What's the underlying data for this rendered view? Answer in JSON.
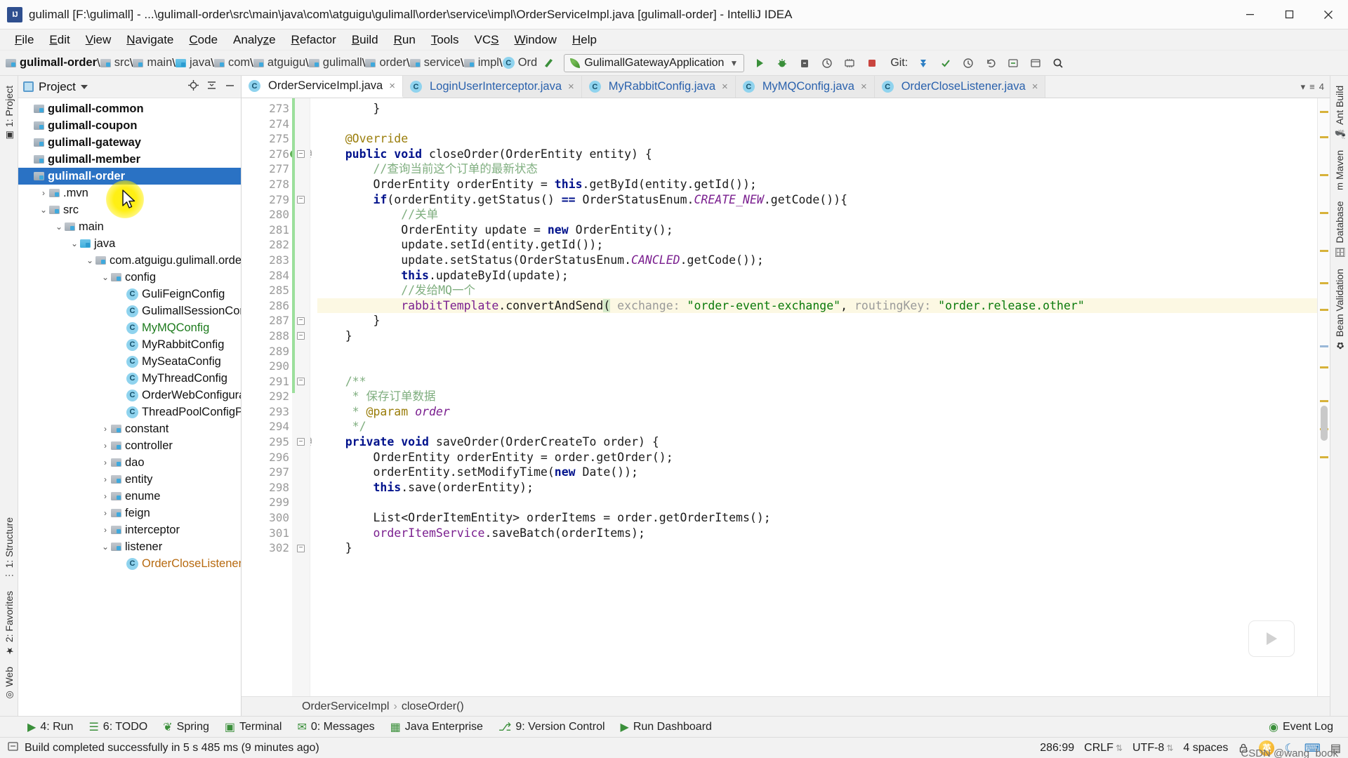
{
  "window": {
    "title": "gulimall [F:\\gulimall] - ...\\gulimall-order\\src\\main\\java\\com\\atguigu\\gulimall\\order\\service\\impl\\OrderServiceImpl.java [gulimall-order] - IntelliJ IDEA",
    "app_icon": "intellij-idea-icon",
    "minimize": "minimize-icon",
    "maximize": "maximize-icon",
    "close": "close-icon"
  },
  "menu": [
    {
      "label": "File",
      "mnemonic": "F"
    },
    {
      "label": "Edit",
      "mnemonic": "E"
    },
    {
      "label": "View",
      "mnemonic": "V"
    },
    {
      "label": "Navigate",
      "mnemonic": "N"
    },
    {
      "label": "Code",
      "mnemonic": "C"
    },
    {
      "label": "Analyze",
      "mnemonic": "z"
    },
    {
      "label": "Refactor",
      "mnemonic": "R"
    },
    {
      "label": "Build",
      "mnemonic": "B"
    },
    {
      "label": "Run",
      "mnemonic": "R"
    },
    {
      "label": "Tools",
      "mnemonic": "T"
    },
    {
      "label": "VCS",
      "mnemonic": "S"
    },
    {
      "label": "Window",
      "mnemonic": "W"
    },
    {
      "label": "Help",
      "mnemonic": "H"
    }
  ],
  "navbar": {
    "crumbs": [
      {
        "label": "gulimall-order",
        "icon": "module-folder-icon",
        "bold": true
      },
      {
        "label": "src",
        "icon": "folder-icon"
      },
      {
        "label": "main",
        "icon": "folder-icon"
      },
      {
        "label": "java",
        "icon": "source-folder-icon"
      },
      {
        "label": "com",
        "icon": "package-icon"
      },
      {
        "label": "atguigu",
        "icon": "package-icon"
      },
      {
        "label": "gulimall",
        "icon": "package-icon"
      },
      {
        "label": "order",
        "icon": "package-icon"
      },
      {
        "label": "service",
        "icon": "package-icon"
      },
      {
        "label": "impl",
        "icon": "package-icon"
      },
      {
        "label": "Ord",
        "icon": "class-icon"
      }
    ],
    "run_config": "GulimallGatewayApplication",
    "git_label": "Git:",
    "buttons": [
      "build-icon",
      "run-icon",
      "debug-icon",
      "run-with-coverage-icon",
      "profile-icon",
      "stop-icon",
      "git-update-icon",
      "git-commit-icon",
      "history-icon",
      "undo-icon",
      "select-in-icon",
      "settings-icon",
      "search-icon"
    ]
  },
  "left_rail": [
    {
      "label": "1: Project",
      "icon": "project-icon"
    },
    {
      "label": "1: Structure",
      "icon": "structure-icon"
    },
    {
      "label": "2: Favorites",
      "icon": "favorites-icon"
    },
    {
      "label": "Web",
      "icon": "web-icon"
    }
  ],
  "right_rail": [
    {
      "label": "Ant Build",
      "icon": "ant-icon"
    },
    {
      "label": "Maven",
      "icon": "maven-icon"
    },
    {
      "label": "Database",
      "icon": "database-icon"
    },
    {
      "label": "Bean Validation",
      "icon": "bean-validation-icon"
    }
  ],
  "project_panel": {
    "title": "Project",
    "actions": [
      "locate-icon",
      "collapse-all-icon",
      "minimize-icon"
    ],
    "tree": [
      {
        "indent": 0,
        "arrow": "",
        "icon": "module-icon",
        "label": "gulimall-common",
        "bold": true
      },
      {
        "indent": 0,
        "arrow": "",
        "icon": "module-icon",
        "label": "gulimall-coupon",
        "bold": true
      },
      {
        "indent": 0,
        "arrow": "",
        "icon": "module-icon",
        "label": "gulimall-gateway",
        "bold": true
      },
      {
        "indent": 0,
        "arrow": "",
        "icon": "module-icon",
        "label": "gulimall-member",
        "bold": true
      },
      {
        "indent": 0,
        "arrow": "",
        "icon": "module-icon",
        "label": "gulimall-order",
        "bold": true,
        "selected": true
      },
      {
        "indent": 1,
        "arrow": "›",
        "icon": "folder-icon",
        "label": ".mvn"
      },
      {
        "indent": 1,
        "arrow": "⌄",
        "icon": "folder-icon",
        "label": "src"
      },
      {
        "indent": 2,
        "arrow": "⌄",
        "icon": "folder-icon",
        "label": "main"
      },
      {
        "indent": 3,
        "arrow": "⌄",
        "icon": "source-folder-icon",
        "label": "java"
      },
      {
        "indent": 4,
        "arrow": "⌄",
        "icon": "package-icon",
        "label": "com.atguigu.gulimall.order"
      },
      {
        "indent": 5,
        "arrow": "⌄",
        "icon": "package-icon",
        "label": "config"
      },
      {
        "indent": 6,
        "arrow": "",
        "icon": "class-icon",
        "label": "GuliFeignConfig"
      },
      {
        "indent": 6,
        "arrow": "",
        "icon": "class-icon",
        "label": "GulimallSessionConfig"
      },
      {
        "indent": 6,
        "arrow": "",
        "icon": "class-icon",
        "label": "MyMQConfig",
        "color": "green"
      },
      {
        "indent": 6,
        "arrow": "",
        "icon": "class-icon",
        "label": "MyRabbitConfig"
      },
      {
        "indent": 6,
        "arrow": "",
        "icon": "class-icon",
        "label": "MySeataConfig"
      },
      {
        "indent": 6,
        "arrow": "",
        "icon": "class-icon",
        "label": "MyThreadConfig"
      },
      {
        "indent": 6,
        "arrow": "",
        "icon": "class-icon",
        "label": "OrderWebConfiguration"
      },
      {
        "indent": 6,
        "arrow": "",
        "icon": "class-icon",
        "label": "ThreadPoolConfigProperties"
      },
      {
        "indent": 5,
        "arrow": "›",
        "icon": "package-icon",
        "label": "constant"
      },
      {
        "indent": 5,
        "arrow": "›",
        "icon": "package-icon",
        "label": "controller"
      },
      {
        "indent": 5,
        "arrow": "›",
        "icon": "package-icon",
        "label": "dao"
      },
      {
        "indent": 5,
        "arrow": "›",
        "icon": "package-icon",
        "label": "entity"
      },
      {
        "indent": 5,
        "arrow": "›",
        "icon": "package-icon",
        "label": "enume"
      },
      {
        "indent": 5,
        "arrow": "›",
        "icon": "package-icon",
        "label": "feign"
      },
      {
        "indent": 5,
        "arrow": "›",
        "icon": "package-icon",
        "label": "interceptor"
      },
      {
        "indent": 5,
        "arrow": "⌄",
        "icon": "package-icon",
        "label": "listener"
      },
      {
        "indent": 6,
        "arrow": "",
        "icon": "class-icon",
        "label": "OrderCloseListener",
        "color": "orange"
      }
    ]
  },
  "editor": {
    "tabs": [
      {
        "label": "OrderServiceImpl.java",
        "icon": "java-class-icon",
        "active": true
      },
      {
        "label": "LoginUserInterceptor.java",
        "icon": "java-class-icon",
        "active": false
      },
      {
        "label": "MyRabbitConfig.java",
        "icon": "java-class-icon",
        "active": false
      },
      {
        "label": "MyMQConfig.java",
        "icon": "java-class-icon",
        "active": false
      },
      {
        "label": "OrderCloseListener.java",
        "icon": "java-class-icon",
        "active": false
      }
    ],
    "tab_overflow": "4",
    "first_line": 273,
    "lines": [
      {
        "n": 273,
        "tokens": [
          {
            "t": "        }",
            "c": "ident"
          }
        ]
      },
      {
        "n": 274,
        "tokens": []
      },
      {
        "n": 275,
        "tokens": [
          {
            "t": "    ",
            "c": "ident"
          },
          {
            "t": "@Override",
            "c": "ann"
          }
        ]
      },
      {
        "n": 276,
        "tokens": [
          {
            "t": "    ",
            "c": "ident"
          },
          {
            "t": "public",
            "c": "kw"
          },
          {
            "t": " ",
            "c": "ident"
          },
          {
            "t": "void",
            "c": "kw"
          },
          {
            "t": " closeOrder(OrderEntity entity) {",
            "c": "ident"
          }
        ],
        "gutter": [
          "breakpoint",
          "override-arrow",
          "annotation"
        ],
        "fold": true
      },
      {
        "n": 277,
        "tokens": [
          {
            "t": "        ",
            "c": "ident"
          },
          {
            "t": "//查询当前这个订单的最新状态",
            "c": "cmt"
          }
        ]
      },
      {
        "n": 278,
        "tokens": [
          {
            "t": "        OrderEntity orderEntity = ",
            "c": "ident"
          },
          {
            "t": "this",
            "c": "kw"
          },
          {
            "t": ".getById(entity.getId());",
            "c": "ident"
          }
        ]
      },
      {
        "n": 279,
        "tokens": [
          {
            "t": "        ",
            "c": "ident"
          },
          {
            "t": "if",
            "c": "kw"
          },
          {
            "t": "(orderEntity.getStatus() ",
            "c": "ident"
          },
          {
            "t": "==",
            "c": "kw"
          },
          {
            "t": " OrderStatusEnum.",
            "c": "ident"
          },
          {
            "t": "CREATE_NEW",
            "c": "stat"
          },
          {
            "t": ".getCode()){",
            "c": "ident"
          }
        ],
        "fold": true
      },
      {
        "n": 280,
        "tokens": [
          {
            "t": "            ",
            "c": "ident"
          },
          {
            "t": "//关单",
            "c": "cmt"
          }
        ]
      },
      {
        "n": 281,
        "tokens": [
          {
            "t": "            OrderEntity update = ",
            "c": "ident"
          },
          {
            "t": "new",
            "c": "kw"
          },
          {
            "t": " OrderEntity();",
            "c": "ident"
          }
        ]
      },
      {
        "n": 282,
        "tokens": [
          {
            "t": "            update.setId(entity.getId());",
            "c": "ident"
          }
        ]
      },
      {
        "n": 283,
        "tokens": [
          {
            "t": "            update.setStatus(OrderStatusEnum.",
            "c": "ident"
          },
          {
            "t": "CANCLED",
            "c": "stat"
          },
          {
            "t": ".getCode());",
            "c": "ident"
          }
        ]
      },
      {
        "n": 284,
        "tokens": [
          {
            "t": "            ",
            "c": "ident"
          },
          {
            "t": "this",
            "c": "kw"
          },
          {
            "t": ".updateById(update);",
            "c": "ident"
          }
        ]
      },
      {
        "n": 285,
        "tokens": [
          {
            "t": "            ",
            "c": "ident"
          },
          {
            "t": "//发给MQ一个",
            "c": "cmt"
          }
        ]
      },
      {
        "n": 286,
        "highlight": true,
        "tokens": [
          {
            "t": "            ",
            "c": "ident"
          },
          {
            "t": "rabbitTemplate",
            "c": "fld"
          },
          {
            "t": ".convertAndSend",
            "c": "ident"
          },
          {
            "t": "(",
            "c": "brace"
          },
          {
            "t": " exchange: ",
            "c": "hint"
          },
          {
            "t": "\"order-event-exchange\"",
            "c": "str"
          },
          {
            "t": ", ",
            "c": "ident"
          },
          {
            "t": "routingKey: ",
            "c": "hint"
          },
          {
            "t": "\"order.release.other\"",
            "c": "str"
          }
        ]
      },
      {
        "n": 287,
        "tokens": [
          {
            "t": "        }",
            "c": "ident"
          }
        ],
        "fold": true
      },
      {
        "n": 288,
        "tokens": [
          {
            "t": "    }",
            "c": "ident"
          }
        ],
        "fold": true
      },
      {
        "n": 289,
        "tokens": []
      },
      {
        "n": 290,
        "tokens": []
      },
      {
        "n": 291,
        "tokens": [
          {
            "t": "    ",
            "c": "ident"
          },
          {
            "t": "/**",
            "c": "doc"
          }
        ],
        "fold": true
      },
      {
        "n": 292,
        "tokens": [
          {
            "t": "     * ",
            "c": "doc"
          },
          {
            "t": "保存订单数据",
            "c": "doc"
          }
        ]
      },
      {
        "n": 293,
        "tokens": [
          {
            "t": "     * ",
            "c": "doc"
          },
          {
            "t": "@param",
            "c": "docTag"
          },
          {
            "t": " order",
            "c": "docParam"
          }
        ]
      },
      {
        "n": 294,
        "tokens": [
          {
            "t": "     */",
            "c": "doc"
          }
        ]
      },
      {
        "n": 295,
        "tokens": [
          {
            "t": "    ",
            "c": "ident"
          },
          {
            "t": "private",
            "c": "kw"
          },
          {
            "t": " ",
            "c": "ident"
          },
          {
            "t": "void",
            "c": "kw"
          },
          {
            "t": " saveOrder(OrderCreateTo order) {",
            "c": "ident"
          }
        ],
        "gutter": [
          "annotation"
        ],
        "fold": true
      },
      {
        "n": 296,
        "tokens": [
          {
            "t": "        OrderEntity orderEntity = order.getOrder();",
            "c": "ident"
          }
        ]
      },
      {
        "n": 297,
        "tokens": [
          {
            "t": "        orderEntity.setModifyTime(",
            "c": "ident"
          },
          {
            "t": "new",
            "c": "kw"
          },
          {
            "t": " Date());",
            "c": "ident"
          }
        ]
      },
      {
        "n": 298,
        "tokens": [
          {
            "t": "        ",
            "c": "ident"
          },
          {
            "t": "this",
            "c": "kw"
          },
          {
            "t": ".save(orderEntity);",
            "c": "ident"
          }
        ]
      },
      {
        "n": 299,
        "tokens": []
      },
      {
        "n": 300,
        "tokens": [
          {
            "t": "        List<OrderItemEntity> orderItems = order.getOrderItems();",
            "c": "ident"
          }
        ]
      },
      {
        "n": 301,
        "tokens": [
          {
            "t": "        ",
            "c": "ident"
          },
          {
            "t": "orderItemService",
            "c": "fld"
          },
          {
            "t": ".saveBatch(orderItems);",
            "c": "ident"
          }
        ]
      },
      {
        "n": 302,
        "tokens": [
          {
            "t": "    }",
            "c": "ident"
          }
        ],
        "fold": true
      }
    ],
    "breadcrumb": [
      "OrderServiceImpl",
      "closeOrder()"
    ]
  },
  "bottom_bar": {
    "items": [
      {
        "label": "4: Run",
        "icon": "run-icon"
      },
      {
        "label": "6: TODO",
        "icon": "todo-icon"
      },
      {
        "label": "Spring",
        "icon": "spring-icon"
      },
      {
        "label": "Terminal",
        "icon": "terminal-icon"
      },
      {
        "label": "0: Messages",
        "icon": "messages-icon"
      },
      {
        "label": "Java Enterprise",
        "icon": "java-enterprise-icon"
      },
      {
        "label": "9: Version Control",
        "icon": "version-control-icon"
      },
      {
        "label": "Run Dashboard",
        "icon": "run-dashboard-icon"
      }
    ],
    "event_log": "Event Log"
  },
  "status_bar": {
    "message": "Build completed successfully in 5 s 485 ms (9 minutes ago)",
    "message_icon": "build-status-icon",
    "caret": "286:99",
    "line_separator": "CRLF",
    "encoding": "UTF-8",
    "indent": "4 spaces",
    "ime": "英",
    "icons": [
      "lock-icon",
      "ime-icon",
      "keyboard-icon",
      "notebook-icon"
    ]
  },
  "watermark": "CSDN @wang_book",
  "colors": {
    "selection_blue": "#2a72c4",
    "highlight_yellow": "#ffee00",
    "string_green": "#0a7a0a",
    "keyword_blue": "#00128c",
    "comment_green": "#7fae7f",
    "annotation_gold": "#9a7d0a",
    "line_highlight": "#fcf8e3"
  }
}
